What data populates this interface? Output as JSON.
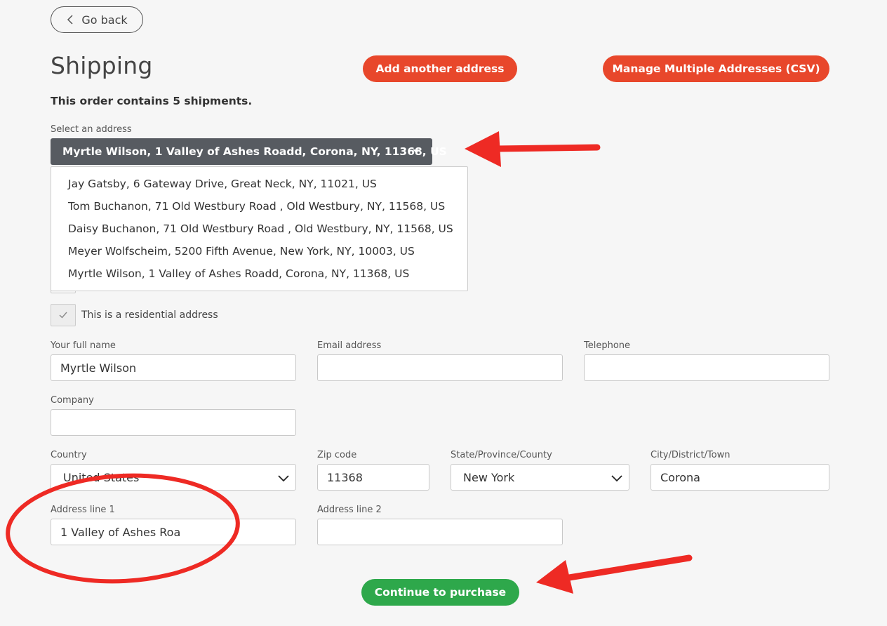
{
  "nav": {
    "go_back_label": "Go back"
  },
  "header": {
    "title": "Shipping",
    "add_address_label": "Add another address",
    "manage_csv_label": "Manage Multiple Addresses (CSV)"
  },
  "order_info": "This order contains 5 shipments.",
  "address_select": {
    "label": "Select an address",
    "selected": "Myrtle Wilson, 1 Valley of Ashes Roadd, Corona, NY, 11368, US",
    "options": [
      "Jay Gatsby, 6 Gateway Drive, Great Neck, NY, 11021, US",
      "Tom Buchanon, 71 Old Westbury Road , Old Westbury, NY, 11568, US",
      "Daisy Buchanon, 71 Old Westbury Road , Old Westbury, NY, 11568, US",
      "Meyer Wolfscheim, 5200 Fifth Avenue, New York, NY, 10003, US",
      "Myrtle Wilson, 1 Valley of Ashes Roadd, Corona, NY, 11368, US"
    ]
  },
  "residential": {
    "label": "This is a residential address",
    "checked": true
  },
  "form": {
    "full_name": {
      "label": "Your full name",
      "value": "Myrtle Wilson"
    },
    "email": {
      "label": "Email address",
      "value": ""
    },
    "telephone": {
      "label": "Telephone",
      "value": ""
    },
    "company": {
      "label": "Company",
      "value": ""
    },
    "country": {
      "label": "Country",
      "value": "United States"
    },
    "zip": {
      "label": "Zip code",
      "value": "11368"
    },
    "state": {
      "label": "State/Province/County",
      "value": "New York"
    },
    "city": {
      "label": "City/District/Town",
      "value": "Corona"
    },
    "address1": {
      "label": "Address line 1",
      "value": "1 Valley of Ashes Roa"
    },
    "address2": {
      "label": "Address line 2",
      "value": ""
    }
  },
  "continue_label": "Continue to purchase",
  "colors": {
    "accent_orange": "#e8472b",
    "accent_green": "#2ea84b",
    "annotation_red": "#ee2a24",
    "select_dark": "#575b61"
  },
  "icons": [
    "chevron-left-icon",
    "caret-down-icon",
    "check-icon",
    "chevron-down-icon"
  ]
}
